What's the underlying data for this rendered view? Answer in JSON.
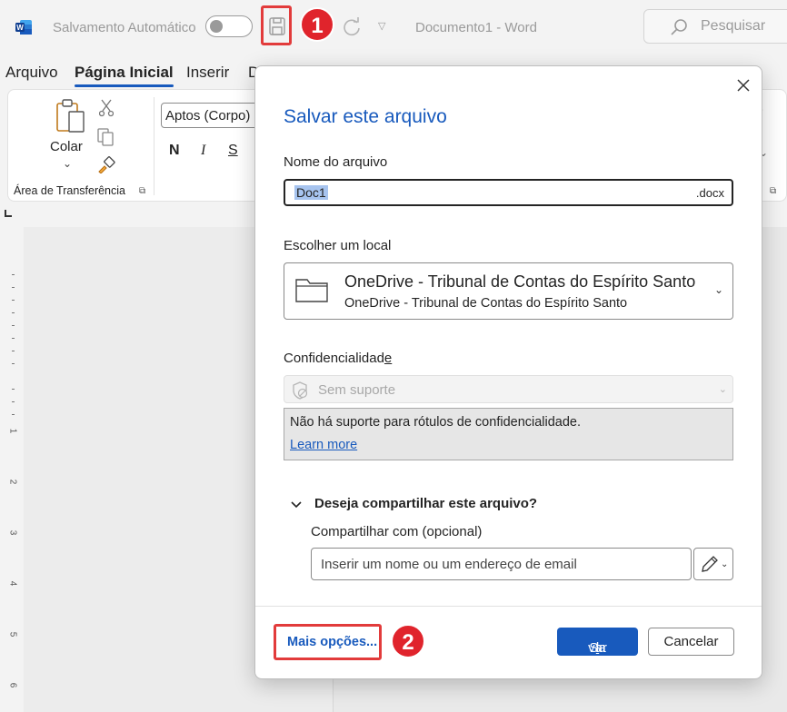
{
  "titlebar": {
    "app_icon": "word-logo",
    "autosave_label": "Salvamento Automático",
    "document_title": "Documento1  -  Word",
    "search_placeholder": "Pesquisar",
    "badge_1": "1"
  },
  "tabs": [
    "Arquivo",
    "Página Inicial",
    "Inserir",
    "D"
  ],
  "ribbon": {
    "paste_label": "Colar",
    "clipboard_group": "Área de Transferência",
    "font_name": "Aptos (Corpo)",
    "bold": "N",
    "italic": "I",
    "strike": "S"
  },
  "ruler": {
    "marks": [
      "1",
      "2",
      "3",
      "4",
      "5",
      "6"
    ]
  },
  "dialog": {
    "title": "Salvar este arquivo",
    "filename_label": "Nome do arquivo",
    "filename_value": "Doc1",
    "filename_ext": ".docx",
    "location_label": "Escolher um local",
    "location_name": "OneDrive - Tribunal de Contas do Espírito Santo",
    "location_sub": "OneDrive - Tribunal de Contas do Espírito Santo",
    "sensitivity_label_main": "Confidencialidad",
    "sensitivity_label_tail": "e",
    "sensitivity_value": "Sem suporte",
    "sensitivity_info": "Não há suporte para rótulos de confidencialidade.",
    "learn_more": "Learn more",
    "share_heading": "Deseja compartilhar este arquivo?",
    "share_with_label": "Compartilhar com (opcional)",
    "share_placeholder": "Inserir um nome ou um endereço de email",
    "more_options": "Mais opções...",
    "save_pre": "Sa",
    "save_ul": "l",
    "save_post": "var",
    "cancel": "Cancelar",
    "badge_2": "2"
  },
  "colors": {
    "accent": "#185abd",
    "highlight_border": "#e23b3b",
    "badge": "#e0242c"
  }
}
